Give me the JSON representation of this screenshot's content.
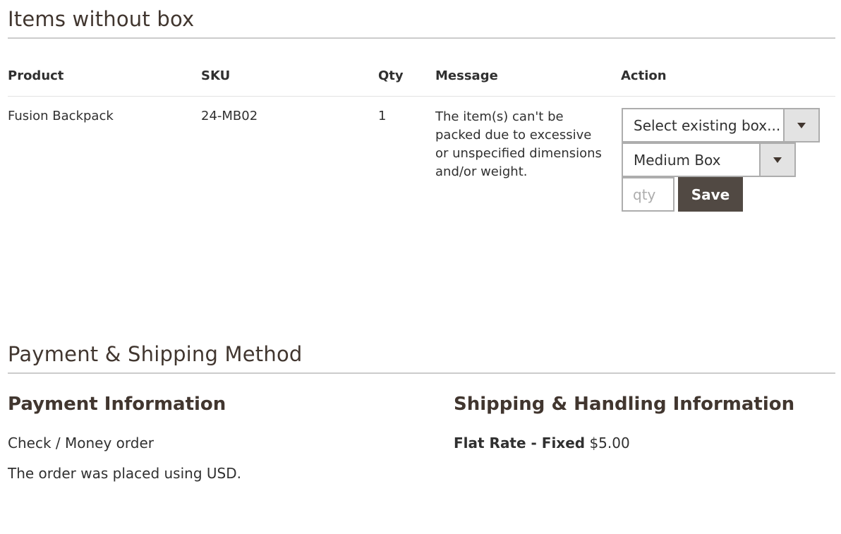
{
  "items_without_box": {
    "title": "Items without box",
    "columns": {
      "product": "Product",
      "sku": "SKU",
      "qty": "Qty",
      "message": "Message",
      "action": "Action"
    },
    "row": {
      "product": "Fusion Backpack",
      "sku": "24-MB02",
      "qty": "1",
      "message": "The item(s) can't be packed due to excessive or unspecified dimensions and/or weight.",
      "existing_box_select": "Select existing box...",
      "box_type_select": "Medium Box",
      "qty_placeholder": "qty",
      "save_label": "Save"
    }
  },
  "payment_shipping": {
    "title": "Payment & Shipping Method",
    "payment": {
      "title": "Payment Information",
      "method": "Check / Money order",
      "currency_note": "The order was placed using USD."
    },
    "shipping": {
      "title": "Shipping & Handling Information",
      "method_label": "Flat Rate - Fixed",
      "price": "$5.00"
    }
  },
  "colors": {
    "button_bg": "#514943",
    "heading": "#41362f",
    "border": "#adadad"
  }
}
